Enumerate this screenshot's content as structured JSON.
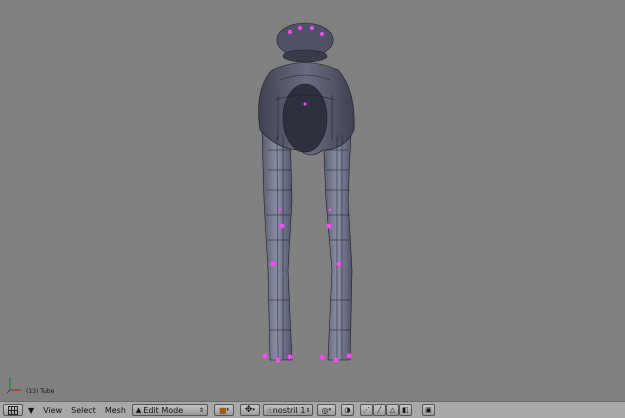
{
  "viewport": {
    "object_info": "(13) Tube"
  },
  "header": {
    "menus": [
      "View",
      "Select",
      "Mesh"
    ],
    "mode": {
      "label": "Edit Mode",
      "icon": "triangle-mesh-icon"
    },
    "pivot_icon": "pivot-cube-icon",
    "transform_icon": "move-arrows-icon",
    "shape_key": {
      "label": "nostril 1",
      "icon": "hand-pointer-icon"
    },
    "icons": [
      "window-type-grid-icon",
      "menu-collapse-icon",
      "proportional-icon",
      "snap-magnet-icon",
      "vertex-select-icon",
      "edge-select-icon",
      "face-select-icon",
      "occlude-geometry-icon",
      "render-preview-icon"
    ]
  },
  "colors": {
    "background": "#808080",
    "mesh_fill": "#5d6074",
    "wire": "#1c1d28",
    "selected_vertex": "#ff44ff",
    "header": "#a8a8a8"
  }
}
